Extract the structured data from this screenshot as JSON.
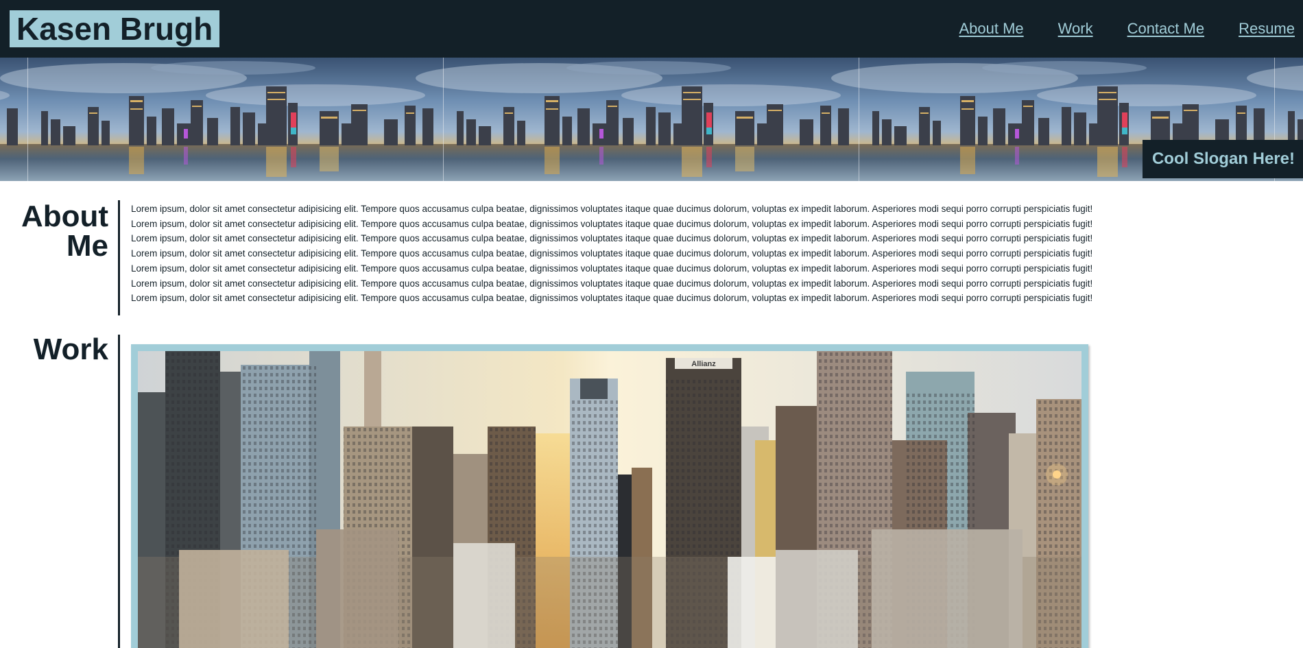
{
  "header": {
    "logo": "Kasen Brugh",
    "nav": [
      {
        "label": "About Me"
      },
      {
        "label": "Work"
      },
      {
        "label": "Contact Me"
      },
      {
        "label": "Resume"
      }
    ]
  },
  "hero": {
    "slogan": "Cool Slogan Here!"
  },
  "about": {
    "title_line1": "About",
    "title_line2": "Me",
    "paragraphs": [
      "Lorem ipsum, dolor sit amet consectetur adipisicing elit. Tempore quos accusamus culpa beatae, dignissimos voluptates itaque quae ducimus dolorum, voluptas ex impedit laborum. Asperiores modi sequi porro corrupti perspiciatis fugit!",
      "Lorem ipsum, dolor sit amet consectetur adipisicing elit. Tempore quos accusamus culpa beatae, dignissimos voluptates itaque quae ducimus dolorum, voluptas ex impedit laborum. Asperiores modi sequi porro corrupti perspiciatis fugit!",
      "Lorem ipsum, dolor sit amet consectetur adipisicing elit. Tempore quos accusamus culpa beatae, dignissimos voluptates itaque quae ducimus dolorum, voluptas ex impedit laborum. Asperiores modi sequi porro corrupti perspiciatis fugit!",
      "Lorem ipsum, dolor sit amet consectetur adipisicing elit. Tempore quos accusamus culpa beatae, dignissimos voluptates itaque quae ducimus dolorum, voluptas ex impedit laborum. Asperiores modi sequi porro corrupti perspiciatis fugit!",
      "Lorem ipsum, dolor sit amet consectetur adipisicing elit. Tempore quos accusamus culpa beatae, dignissimos voluptates itaque quae ducimus dolorum, voluptas ex impedit laborum. Asperiores modi sequi porro corrupti perspiciatis fugit!",
      "Lorem ipsum, dolor sit amet consectetur adipisicing elit. Tempore quos accusamus culpa beatae, dignissimos voluptates itaque quae ducimus dolorum, voluptas ex impedit laborum. Asperiores modi sequi porro corrupti perspiciatis fugit!",
      "Lorem ipsum, dolor sit amet consectetur adipisicing elit. Tempore quos accusamus culpa beatae, dignissimos voluptates itaque quae ducimus dolorum, voluptas ex impedit laborum. Asperiores modi sequi porro corrupti perspiciatis fugit!"
    ]
  },
  "work": {
    "title": "Work",
    "image_sign": "Allianz"
  },
  "colors": {
    "dark": "#132028",
    "accent": "#a1cdd8",
    "background": "#ffffff"
  }
}
